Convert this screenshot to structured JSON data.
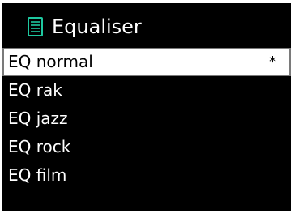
{
  "header": {
    "title": "Equaliser",
    "icon": "list-icon",
    "icon_color": "#1ec8a0"
  },
  "menu": {
    "items": [
      {
        "label": "EQ normal",
        "marker": "*",
        "selected": true
      },
      {
        "label": "EQ rak",
        "selected": false
      },
      {
        "label": "EQ jazz",
        "selected": false
      },
      {
        "label": "EQ rock",
        "selected": false
      },
      {
        "label": "EQ film",
        "selected": false
      }
    ]
  },
  "colors": {
    "background": "#000000",
    "text": "#ffffff",
    "selected_background": "#ffffff",
    "selected_text": "#000000"
  }
}
